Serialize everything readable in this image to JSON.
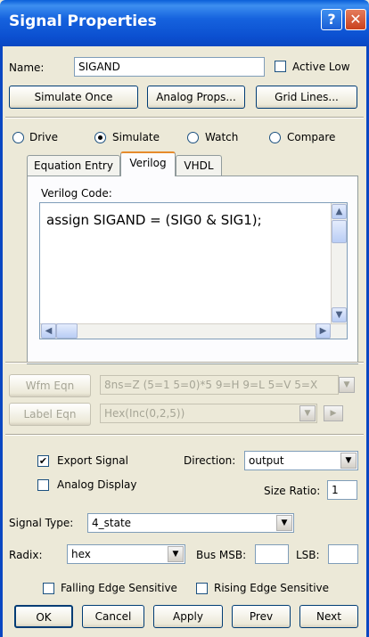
{
  "window": {
    "title": "Signal Properties",
    "help_glyph": "?",
    "close_glyph": "✕"
  },
  "name": {
    "label": "Name:",
    "value": "SIGAND",
    "active_low_label": "Active Low",
    "active_low_checked": false
  },
  "buttons_top": {
    "simulate_once": "Simulate Once",
    "analog_props": "Analog Props...",
    "grid_lines": "Grid Lines..."
  },
  "modes": [
    {
      "label": "Drive",
      "selected": false
    },
    {
      "label": "Simulate",
      "selected": true
    },
    {
      "label": "Watch",
      "selected": false
    },
    {
      "label": "Compare",
      "selected": false
    }
  ],
  "tabs": [
    {
      "label": "Equation Entry",
      "active": false
    },
    {
      "label": "Verilog",
      "active": true
    },
    {
      "label": "VHDL",
      "active": false
    }
  ],
  "verilog": {
    "label": "Verilog Code:",
    "code": "assign SIGAND = (SIG0 & SIG1);"
  },
  "wfm": {
    "button": "Wfm Eqn",
    "value": "8ns=Z (5=1 5=0)*5 9=H 9=L 5=V 5=X"
  },
  "label_eqn": {
    "button": "Label Eqn",
    "value": "Hex(Inc(0,2,5))"
  },
  "export_signal": {
    "label": "Export Signal",
    "checked": true
  },
  "direction": {
    "label": "Direction:",
    "value": "output"
  },
  "analog_display": {
    "label": "Analog Display",
    "checked": false
  },
  "size_ratio": {
    "label": "Size Ratio:",
    "value": "1"
  },
  "signal_type": {
    "label": "Signal Type:",
    "value": "4_state"
  },
  "radix": {
    "label": "Radix:",
    "value": "hex"
  },
  "bus_msb": {
    "label": "Bus MSB:",
    "value": ""
  },
  "lsb": {
    "label": "LSB:",
    "value": ""
  },
  "falling_edge": {
    "label": "Falling Edge Sensitive",
    "checked": false
  },
  "rising_edge": {
    "label": "Rising Edge Sensitive",
    "checked": false
  },
  "bottom_buttons": {
    "ok": "OK",
    "cancel": "Cancel",
    "apply": "Apply",
    "prev": "Prev",
    "next": "Next"
  },
  "glyphs": {
    "check": "✔",
    "down": "▼",
    "up": "▲",
    "left": "◀",
    "right": "▶"
  }
}
